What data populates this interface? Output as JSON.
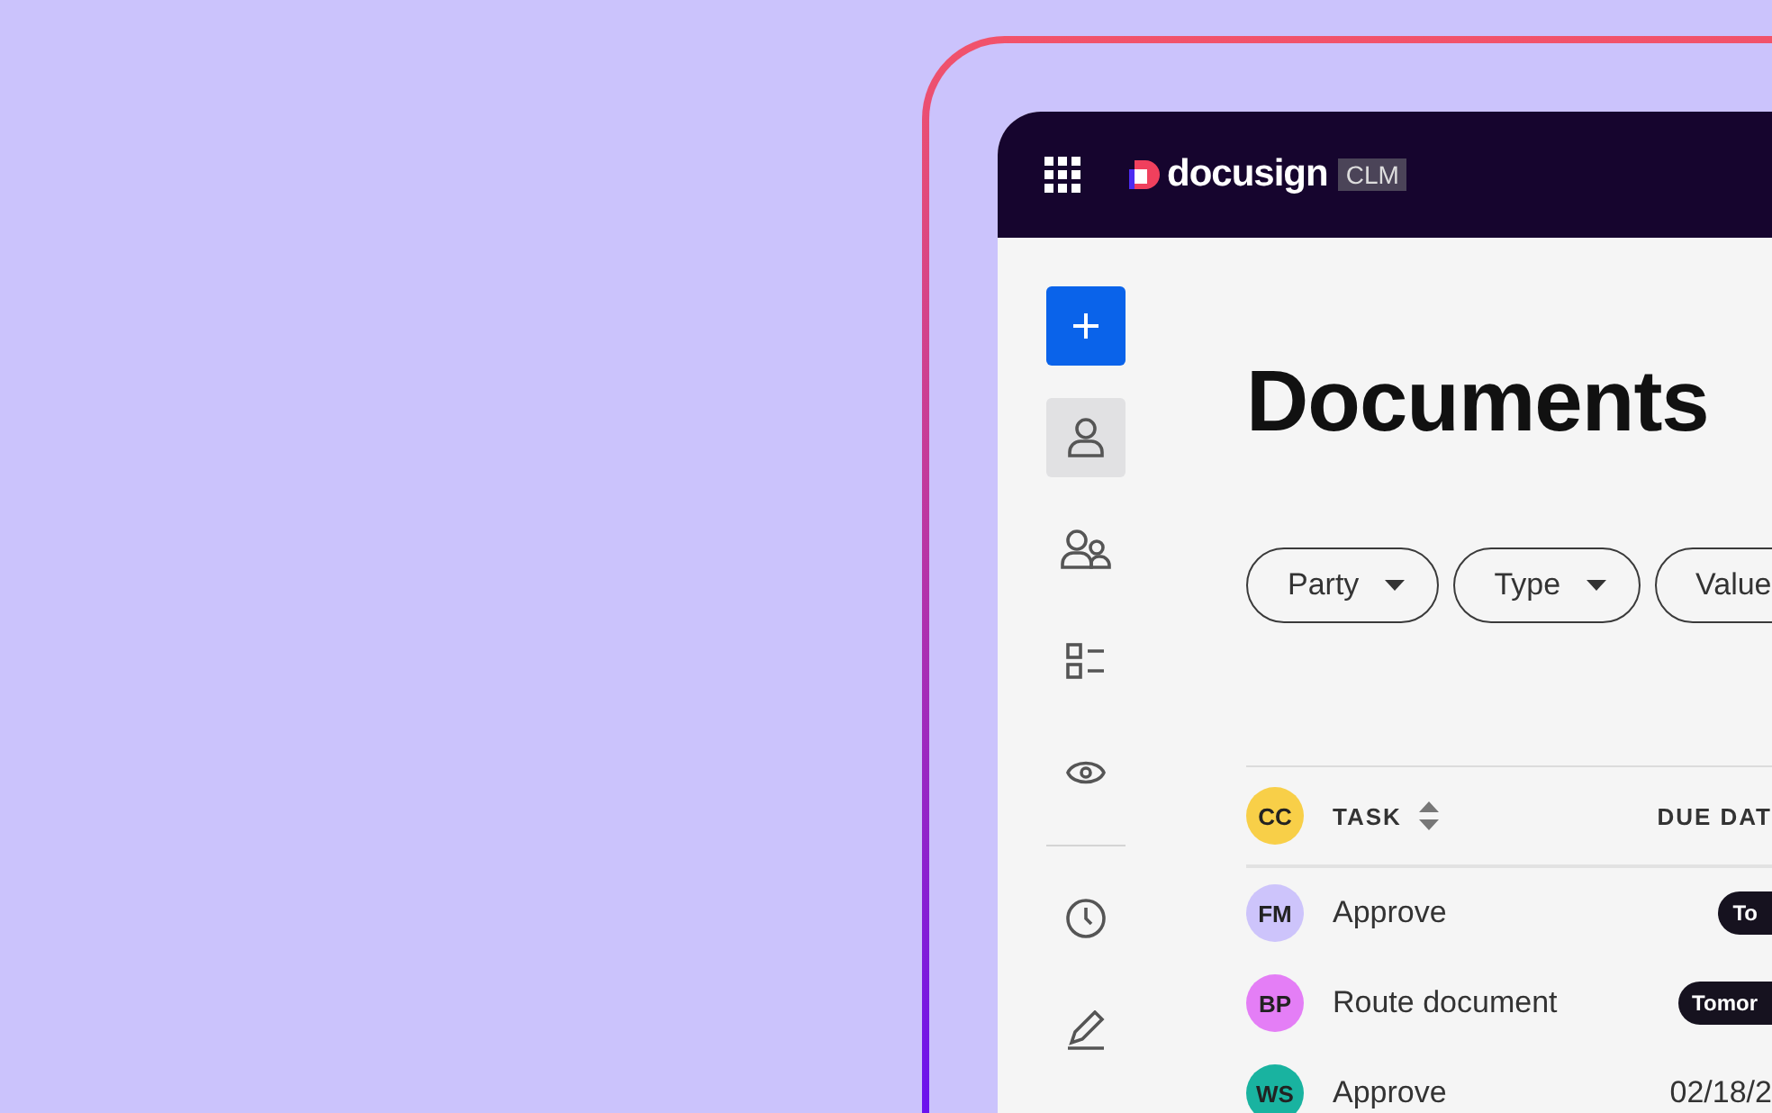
{
  "header": {
    "logo_text": "docusign",
    "product_tag": "CLM"
  },
  "sidebar": {
    "primary": [
      {
        "selected": true
      },
      {
        "selected": false
      },
      {
        "selected": false
      },
      {
        "selected": false
      }
    ],
    "secondary": [
      {
        "selected": false
      },
      {
        "selected": false
      }
    ]
  },
  "page_title": "Documents",
  "filters": [
    {
      "label": "Party"
    },
    {
      "label": "Type"
    },
    {
      "label": "Value"
    }
  ],
  "table": {
    "header": {
      "avatar": {
        "initials": "CC",
        "color": "#f8cf48"
      },
      "task": "TASK",
      "due": "DUE DAT"
    },
    "rows": [
      {
        "initials": "FM",
        "color": "#cdc4fb",
        "task": "Approve",
        "due": {
          "kind": "badge",
          "text": "To"
        }
      },
      {
        "initials": "BP",
        "color": "#e47ef6",
        "task": "Route document",
        "due": {
          "kind": "badge",
          "text": "Tomor"
        }
      },
      {
        "initials": "WS",
        "color": "#19b3a0",
        "task": "Approve",
        "due": {
          "kind": "date",
          "text": "02/18/2"
        }
      }
    ]
  }
}
